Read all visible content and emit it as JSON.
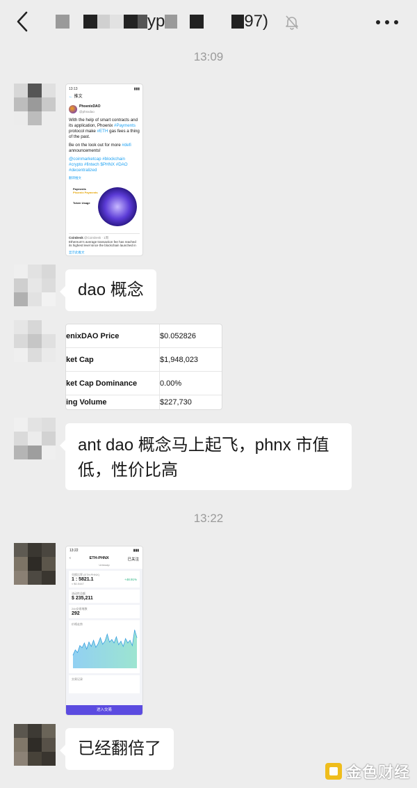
{
  "header": {
    "title_fragment_1": "yp",
    "title_fragment_2": "97)",
    "back_icon": "chevron-left-icon",
    "mute_icon": "bell-muted-icon",
    "more_icon": "more-horizontal-icon"
  },
  "timestamps": [
    "13:09",
    "13:22"
  ],
  "messages": [
    {
      "type": "image",
      "tweet": {
        "status_time": "13:13",
        "header": "推文",
        "account_name": "PhoenixDAO",
        "handle": "@phnxdao",
        "text_1": "With the help of smart contracts and its application, Phoenix ",
        "tag_payments": "#Payments",
        "text_2": " protocol make ",
        "tag_eth": "#ETH",
        "text_3": " gas fees a thing of the past.",
        "text_4": "Be on the look out for more ",
        "tag_defi": "#defi",
        "text_5": " announcements!",
        "tags_line": "@coinmarketcap #blockchain #crypto #fintech $PHNX #DAO #decentralized",
        "translate": "翻译推文",
        "card_title": "Payments",
        "card_sub": "Phoenix Payments",
        "card_usage": "Token Usage",
        "quote_account": "CoinDesk",
        "quote_handle": "@CoinDesk · 1周",
        "quote_text": "Ethereum's average transaction fee has reached its highest level since the blockchain launched in",
        "foot": "显示此推文"
      }
    },
    {
      "type": "text",
      "text": "dao 概念"
    },
    {
      "type": "image",
      "price_table": [
        {
          "k": "enixDAO Price",
          "v": "$0.052826"
        },
        {
          "k": "ket Cap",
          "v": "$1,948,023"
        },
        {
          "k": "ket Cap Dominance",
          "v": "0.00%"
        },
        {
          "k": "ing Volume",
          "v": "$227,730"
        }
      ]
    },
    {
      "type": "text",
      "text_line1": "ant dao 概念马上起飞，phnx 市值",
      "text_line2": "低，性价比高"
    },
    {
      "type": "image",
      "app": {
        "status_time": "13:22",
        "pair": "ETH-PHNX",
        "pair_sub": "Uniswap",
        "back": "‹",
        "right": "已关注",
        "l1": "兑换比率 (ETH:PHNX)",
        "rate": "1 : 5821.1",
        "rate_sub": "≈ $0.0447",
        "change": "+48.91%",
        "l2": "流动性总额",
        "liq": "$ 235,211",
        "l3": "24h交易笔数",
        "tx": "292",
        "l4": "价格走势",
        "l5": "交易记录",
        "btn": "进入交易"
      },
      "chart_data": {
        "type": "area",
        "title": "",
        "values": [
          30,
          42,
          36,
          52,
          47,
          58,
          44,
          60,
          50,
          64,
          48,
          56,
          70,
          55,
          62,
          78,
          60,
          66,
          58,
          72,
          54,
          62,
          50,
          68,
          58,
          64,
          52,
          88,
          70
        ]
      }
    },
    {
      "type": "text",
      "text": "已经翻倍了"
    }
  ],
  "watermark": {
    "text": "金色财经"
  },
  "colors": {
    "background": "#ededed",
    "bubble": "#ffffff",
    "timestamp": "#9a9a9a",
    "link": "#1da1f2",
    "app_accent": "#5b4be0"
  }
}
